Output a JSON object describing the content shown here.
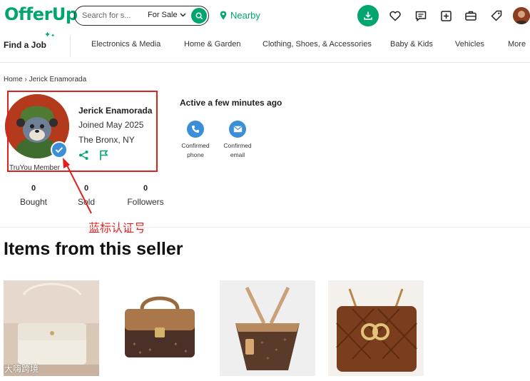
{
  "header": {
    "logo": "OfferUp",
    "search_placeholder": "Search for s...",
    "filter_label": "For Sale",
    "nearby_label": "Nearby"
  },
  "categories": {
    "find_job": "Find a Job",
    "items": [
      "Electronics & Media",
      "Home & Garden",
      "Clothing, Shoes, & Accessories",
      "Baby & Kids",
      "Vehicles",
      "More"
    ]
  },
  "breadcrumb": {
    "home": "Home",
    "separator": "›",
    "current": "Jerick Enamorada"
  },
  "profile": {
    "name": "Jerick Enamorada",
    "joined": "Joined May 2025",
    "location": "The Bronx, NY",
    "truyou": "TruYou Member",
    "activity": "Active a few minutes ago",
    "confirmations": [
      {
        "line1": "Confirmed",
        "line2": "phone"
      },
      {
        "line1": "Confirmed",
        "line2": "email"
      }
    ]
  },
  "stats": [
    {
      "value": "0",
      "label": "Bought"
    },
    {
      "value": "0",
      "label": "Sold"
    },
    {
      "value": "0",
      "label": "Followers"
    }
  ],
  "annotation": {
    "text": "蓝标认证号",
    "color": "#e02020"
  },
  "items_section": {
    "title": "Items from this seller"
  },
  "watermark": "大嗨跨境",
  "colors": {
    "brand": "#01a56f",
    "verify": "#3b8fd9",
    "annotation": "#e02020"
  }
}
